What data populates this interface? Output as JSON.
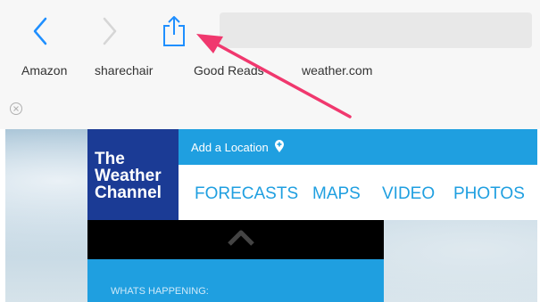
{
  "toolbar": {
    "back_icon": "chevron-left-icon",
    "forward_icon": "chevron-right-icon",
    "share_icon": "share-icon",
    "accent": "#1f8fff"
  },
  "bookmarks": [
    "Amazon",
    "sharechair",
    "Good Reads",
    "weather.com"
  ],
  "page": {
    "logo_lines": [
      "The",
      "Weather",
      "Channel"
    ],
    "add_location": "Add a Location",
    "nav": [
      "FORECASTS",
      "MAPS",
      "VIDEO",
      "PHOTOS"
    ],
    "whats_happening": "WHATS HAPPENING:",
    "brand_blue": "#1f9fe0",
    "logo_blue": "#1b3b95"
  },
  "annotation_arrow_color": "#f0386e"
}
